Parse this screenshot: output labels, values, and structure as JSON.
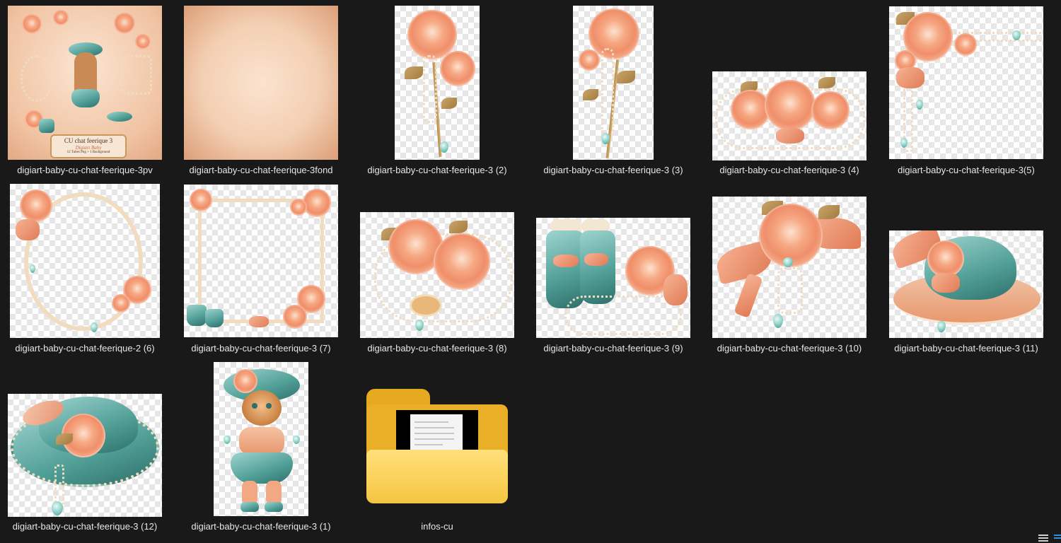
{
  "files": [
    {
      "name": "digiart-baby-cu-chat-feerique-3pv",
      "thumb": "preview-sheet-icon"
    },
    {
      "name": "digiart-baby-cu-chat-feerique-3fond",
      "thumb": "peach-background-paper-icon"
    },
    {
      "name": "digiart-baby-cu-chat-feerique-3 (2)",
      "thumb": "rose-stem-pearls-icon"
    },
    {
      "name": "digiart-baby-cu-chat-feerique-3 (3)",
      "thumb": "rose-stem-pearls-icon"
    },
    {
      "name": "digiart-baby-cu-chat-feerique-3 (4)",
      "thumb": "rose-cluster-pearls-icon"
    },
    {
      "name": "digiart-baby-cu-chat-feerique-3(5)",
      "thumb": "rose-corner-icon"
    },
    {
      "name": "digiart-baby-cu-chat-feerique-2 (6)",
      "thumb": "oval-pearl-frame-icon"
    },
    {
      "name": "digiart-baby-cu-chat-feerique-3 (7)",
      "thumb": "square-pearl-frame-icon"
    },
    {
      "name": "digiart-baby-cu-chat-feerique-3 (8)",
      "thumb": "roses-pearls-icon"
    },
    {
      "name": "digiart-baby-cu-chat-feerique-3 (9)",
      "thumb": "boots-rose-icon"
    },
    {
      "name": "digiart-baby-cu-chat-feerique-3 (10)",
      "thumb": "rose-bow-icon"
    },
    {
      "name": "digiart-baby-cu-chat-feerique-3 (11)",
      "thumb": "hat-icon"
    },
    {
      "name": "digiart-baby-cu-chat-feerique-3 (12)",
      "thumb": "hat-icon"
    },
    {
      "name": "digiart-baby-cu-chat-feerique-3 (1)",
      "thumb": "kitten-icon"
    },
    {
      "name": "infos-cu",
      "thumb": "folder-icon"
    }
  ],
  "preview": {
    "title": "CU chat feerique 3",
    "subtitle": "Digiart Baby",
    "note": "12 Tubes Png + 1 Background"
  },
  "colors": {
    "background": "#191919",
    "text": "#e6e6e6",
    "peach": "#f6a883",
    "teal": "#4f9e96",
    "folder": "#f5c542"
  },
  "statusbar": {
    "view_details": "details-view-icon",
    "view_thumbnails": "large-icons-view-icon"
  }
}
